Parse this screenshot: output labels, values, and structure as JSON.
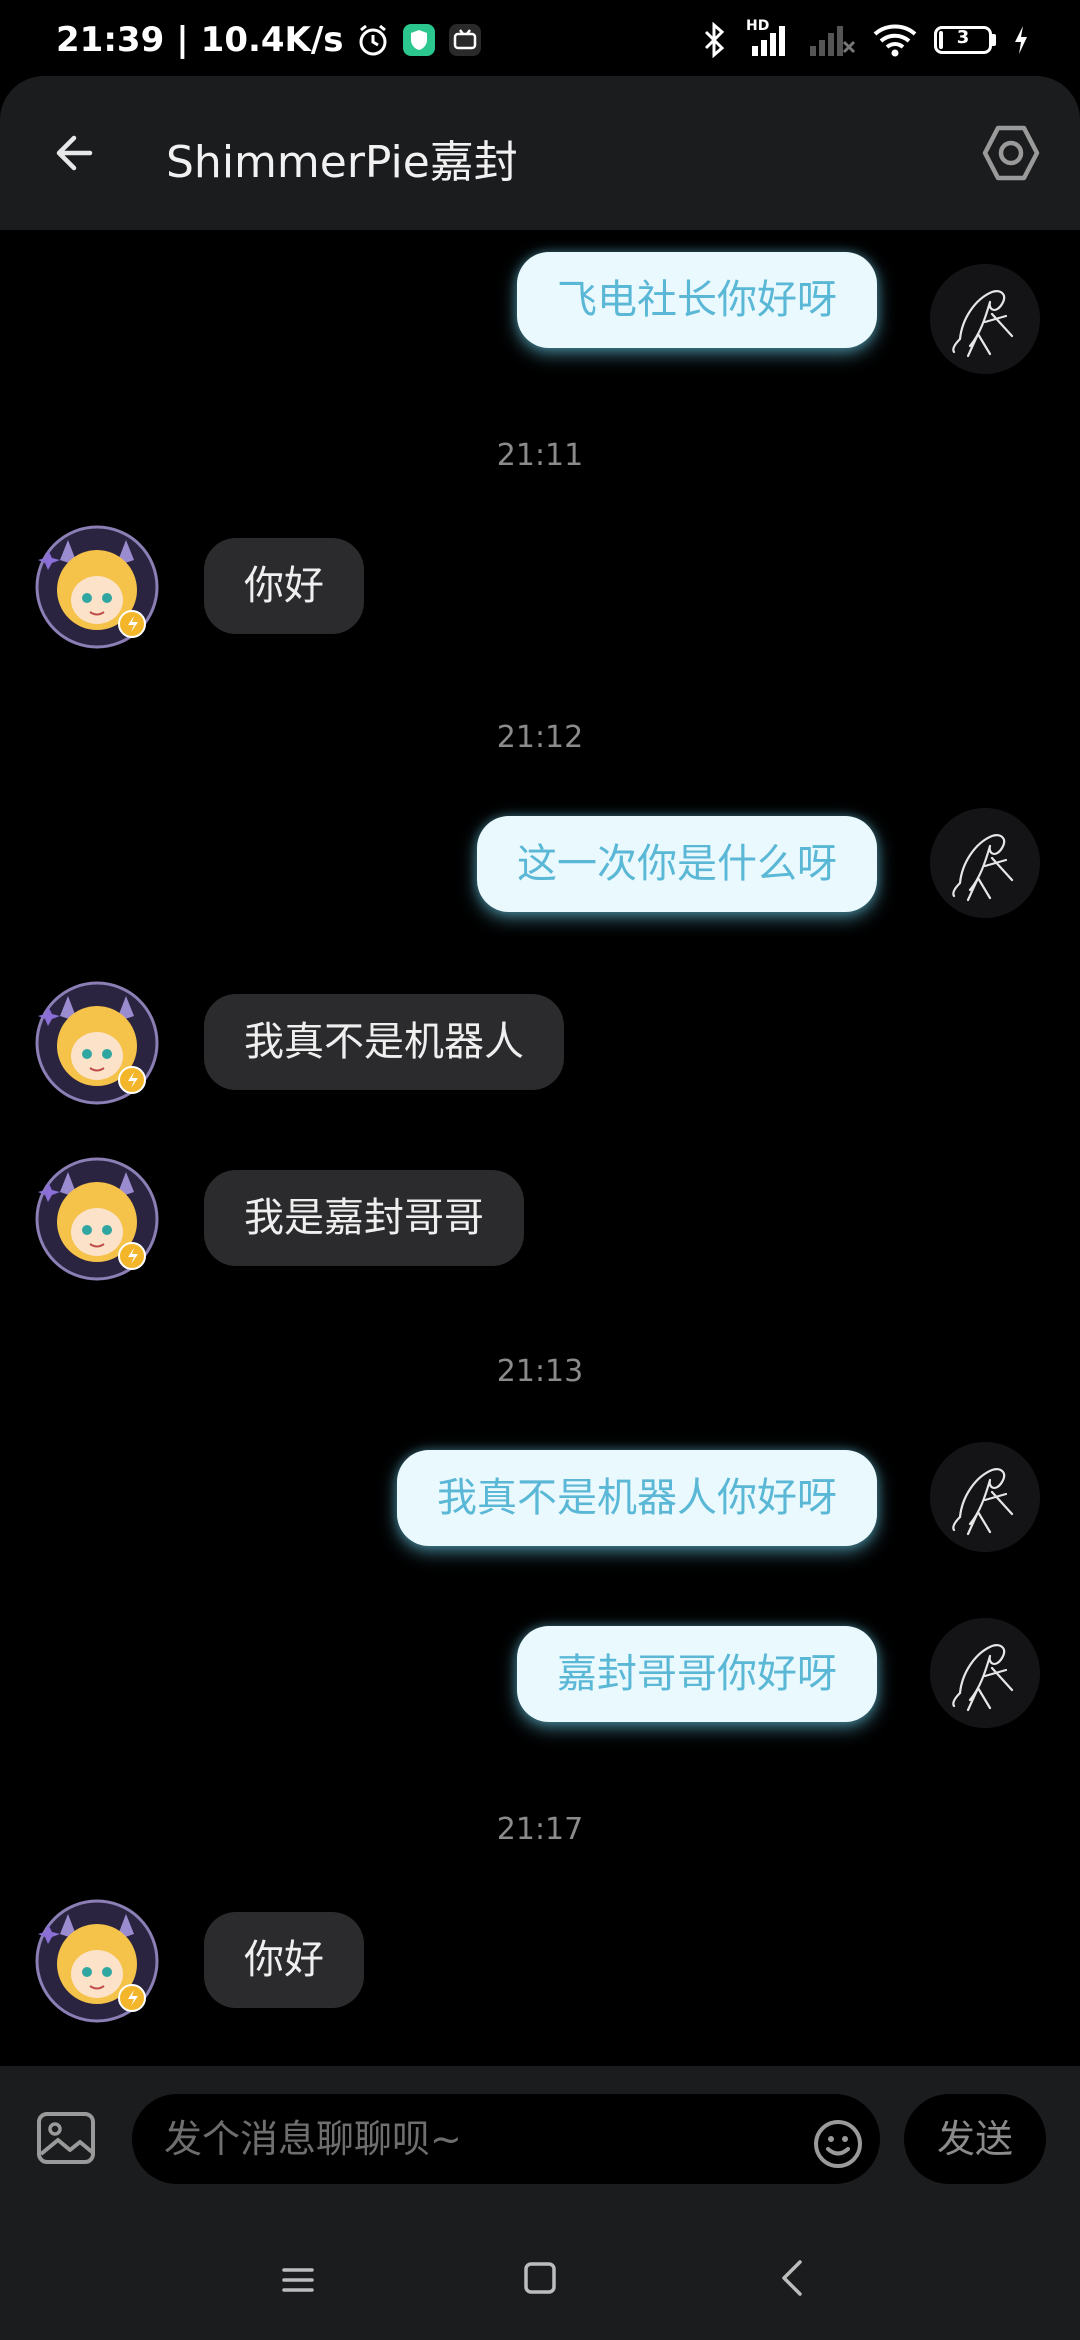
{
  "status_bar": {
    "time": "21:39",
    "net_speed": "10.4K/s",
    "separator": "|",
    "hd_label": "HD",
    "battery_level": "3"
  },
  "header": {
    "title": "ShimmerPie嘉封"
  },
  "messages": [
    {
      "side": "right",
      "text": "飞电社长你好呀"
    },
    {
      "type": "time",
      "text": "21:11"
    },
    {
      "side": "left",
      "text": "你好"
    },
    {
      "type": "time",
      "text": "21:12"
    },
    {
      "side": "right",
      "text": "这一次你是什么呀"
    },
    {
      "side": "left",
      "text": "我真不是机器人"
    },
    {
      "side": "left",
      "text": "我是嘉封哥哥"
    },
    {
      "type": "time",
      "text": "21:13"
    },
    {
      "side": "right",
      "text": "我真不是机器人你好呀"
    },
    {
      "side": "right",
      "text": "嘉封哥哥你好呀"
    },
    {
      "type": "time",
      "text": "21:17"
    },
    {
      "side": "left",
      "text": "你好"
    }
  ],
  "input": {
    "placeholder": "发个消息聊聊呗~",
    "send_label": "发送"
  },
  "colors": {
    "background": "#000000",
    "header": "#1b1c1e",
    "own_bubble": "#eaf9fe",
    "own_text": "#5ab8d6",
    "other_bubble": "#2b2b2d"
  },
  "icons": {
    "back": "arrow-left-icon",
    "settings": "hexagon-settings-icon",
    "image": "image-icon",
    "emoji": "smiley-icon"
  }
}
